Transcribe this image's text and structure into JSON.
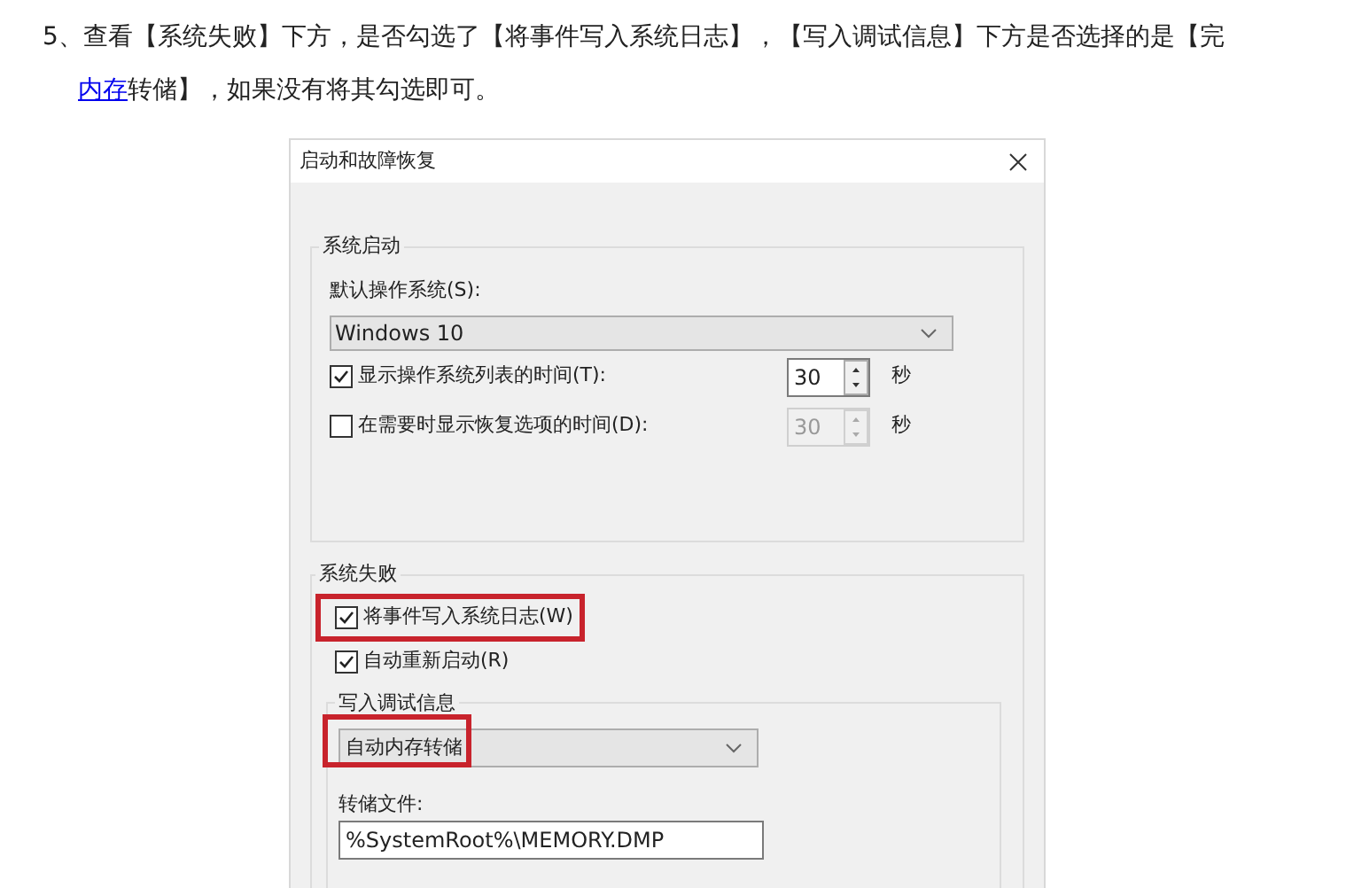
{
  "intro": {
    "text_before": "5、查看【系统失败】下方，是否勾选了【将事件写入系统日志】，【写入调试信息】下方是否选择的是【完",
    "link": "内存",
    "text_after": "转储】，如果没有将其勾选即可。"
  },
  "dialog": {
    "title": "启动和故障恢复",
    "startup": {
      "legend": "系统启动",
      "os_label": "默认操作系统(S):",
      "os_value": "Windows 10",
      "rows": [
        {
          "label": "显示操作系统列表的时间(T):",
          "checked": true,
          "value": "30",
          "unit": "秒",
          "disabled": false
        },
        {
          "label": "在需要时显示恢复选项的时间(D):",
          "checked": false,
          "value": "30",
          "unit": "秒",
          "disabled": true
        }
      ]
    },
    "failure": {
      "legend": "系统失败",
      "checks": [
        {
          "label": "将事件写入系统日志(W)",
          "checked": true,
          "highlighted": true
        },
        {
          "label": "自动重新启动(R)",
          "checked": true,
          "highlighted": false
        }
      ],
      "debug": {
        "legend": "写入调试信息",
        "dump_type": "自动内存转储",
        "dump_highlighted": true,
        "file_label": "转储文件:",
        "file_value": "%SystemRoot%\\MEMORY.DMP"
      }
    }
  }
}
